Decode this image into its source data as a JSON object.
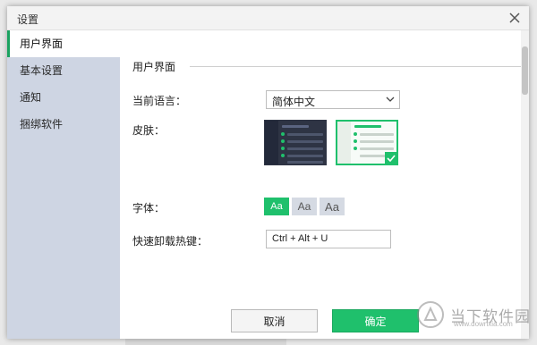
{
  "dialog": {
    "title": "设置"
  },
  "sidebar": {
    "items": [
      {
        "label": "用户界面",
        "active": true
      },
      {
        "label": "基本设置",
        "active": false
      },
      {
        "label": "通知",
        "active": false
      },
      {
        "label": "捆绑软件",
        "active": false
      }
    ]
  },
  "content": {
    "section_title": "用户界面",
    "language": {
      "label": "当前语言：",
      "value": "简体中文"
    },
    "skin": {
      "label": "皮肤：",
      "selected": "light"
    },
    "font": {
      "label": "字体：",
      "options": [
        "Aa",
        "Aa",
        "Aa"
      ],
      "selected_index": 0
    },
    "hotkey": {
      "label": "快速卸载热键：",
      "value": "Ctrl + Alt + U"
    }
  },
  "buttons": {
    "cancel": "取消",
    "ok": "确定"
  },
  "watermark": {
    "text": "当下软件园",
    "sub": "www.downxia.com"
  },
  "colors": {
    "accent": "#1fc06c",
    "sidebar_bg": "#ced5e3",
    "dark_skin": "#2e3444"
  }
}
